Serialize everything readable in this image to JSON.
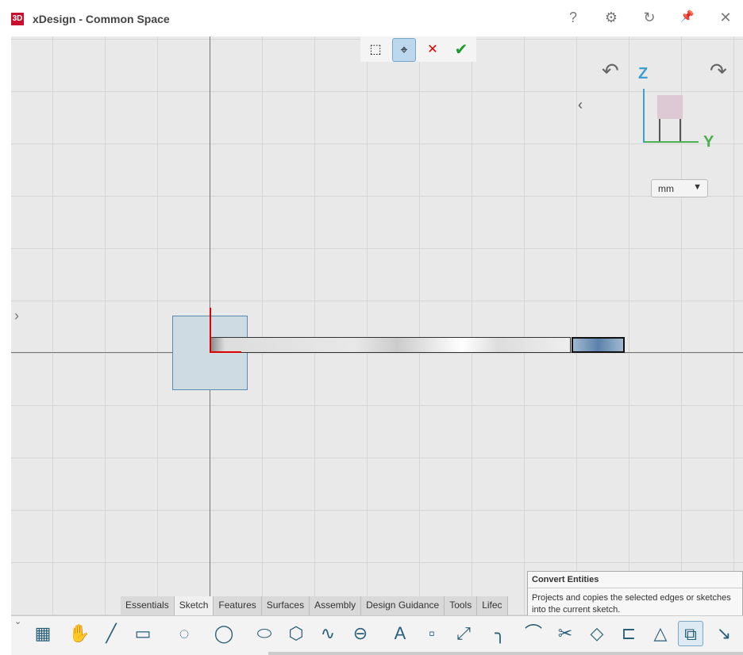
{
  "window": {
    "title": "xDesign - Common Space",
    "logo": "3DS"
  },
  "title_icons": [
    "help-icon",
    "gear-icon",
    "refresh-icon",
    "pin-icon",
    "close-icon"
  ],
  "title_glyphs": [
    "?",
    "⚙",
    "↻",
    "📌",
    "✕"
  ],
  "view": {
    "axis_z": "Z",
    "axis_y": "Y",
    "units": "mm"
  },
  "tabs": [
    "Essentials",
    "Sketch",
    "Features",
    "Surfaces",
    "Assembly",
    "Design Guidance",
    "Tools",
    "Lifec"
  ],
  "active_tab": "Sketch",
  "tooltip": {
    "title": "Convert Entities",
    "body": "Projects and copies the selected edges or sketches into the current sketch."
  },
  "tools": [
    {
      "name": "sketch-grid-icon",
      "g": "▦"
    },
    {
      "name": "freehand-icon",
      "g": "✋"
    },
    {
      "name": "line-icon",
      "g": "╱"
    },
    {
      "name": "rectangle-icon",
      "g": "▭"
    },
    {
      "name": "arc-icon",
      "g": "◌"
    },
    {
      "name": "circle-icon",
      "g": "◯"
    },
    {
      "name": "ellipse-icon",
      "g": "⬭"
    },
    {
      "name": "polygon-icon",
      "g": "⬡"
    },
    {
      "name": "spline-icon",
      "g": "∿"
    },
    {
      "name": "slot-icon",
      "g": "⊖"
    },
    {
      "name": "text-icon",
      "g": "A"
    },
    {
      "name": "point-icon",
      "g": "▫"
    },
    {
      "name": "dimension-icon",
      "g": "⤢"
    },
    {
      "name": "fillet-icon",
      "g": "╮"
    },
    {
      "name": "chamfer-icon",
      "g": "⌒"
    },
    {
      "name": "trim-icon",
      "g": "✂"
    },
    {
      "name": "offset-icon",
      "g": "◇"
    },
    {
      "name": "offset-entities-icon",
      "g": "⊏"
    },
    {
      "name": "mirror-icon",
      "g": "△"
    },
    {
      "name": "convert-entities-icon",
      "g": "⧉"
    },
    {
      "name": "project-icon",
      "g": "↘"
    }
  ]
}
